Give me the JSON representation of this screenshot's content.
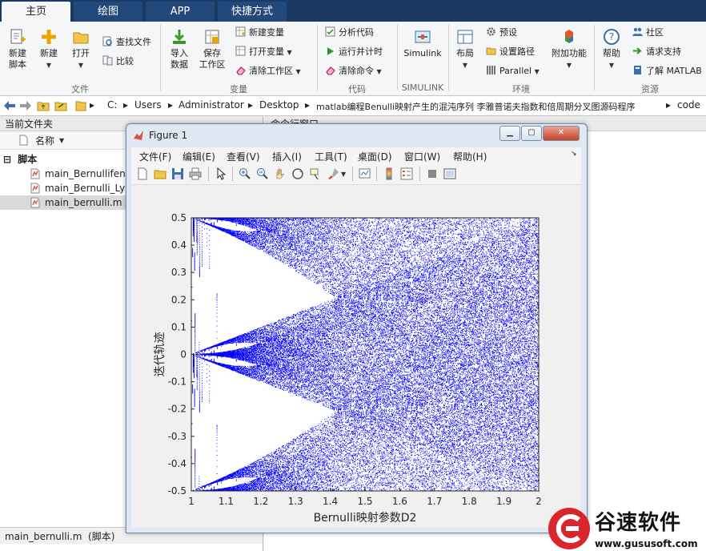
{
  "tabs": [
    {
      "label": "主页",
      "active": true
    },
    {
      "label": "绘图",
      "active": false
    },
    {
      "label": "APP",
      "active": false
    },
    {
      "label": "快捷方式",
      "active": false
    }
  ],
  "ribbon": {
    "new_script": [
      "新建",
      "脚本"
    ],
    "new": "新建",
    "open": "打开",
    "find_files": "查找文件",
    "compare": "比较",
    "group_file": "文件",
    "import": [
      "导入",
      "数据"
    ],
    "save_ws": [
      "保存",
      "工作区"
    ],
    "new_var": "新建变量",
    "open_var": "打开变量",
    "clear_ws": "清除工作区",
    "group_var": "变量",
    "analyze": "分析代码",
    "run_time": "运行并计时",
    "clear_cmd": "清除命令",
    "group_code": "代码",
    "simulink": "Simulink",
    "group_simulink": "SIMULINK",
    "layout": "布局",
    "prefs": "预设",
    "set_path": "设置路径",
    "parallel": "Parallel",
    "addons": "附加功能",
    "group_env": "环境",
    "help": "帮助",
    "community": "社区",
    "request_support": "请求支持",
    "learn_matlab": "了解 MATLAB",
    "group_resources": "资源"
  },
  "address": {
    "crumbs": [
      "C:",
      "Users",
      "Administrator",
      "Desktop",
      "matlab编程Benulli映射产生的混沌序列 李雅普诺夫指数和倍周期分叉图源码程序",
      "code"
    ]
  },
  "left_panel": {
    "title": "当前文件夹",
    "column_name": "名称",
    "folder": "脚本",
    "files": [
      "main_Bernullifenc",
      "main_Bernulli_Lya",
      "main_bernulli.m"
    ],
    "status": "main_bernulli.m  (脚本)"
  },
  "command_window": {
    "title": "命令行窗口"
  },
  "figure": {
    "title": "Figure 1",
    "menu": [
      "文件(F)",
      "编辑(E)",
      "查看(V)",
      "插入(I)",
      "工具(T)",
      "桌面(D)",
      "窗口(W)",
      "帮助(H)"
    ]
  },
  "chart_data": {
    "type": "scatter",
    "xlabel": "Bernulli映射参数D2",
    "ylabel": "迭代轨迹",
    "xlim": [
      1,
      2
    ],
    "ylim": [
      -0.5,
      0.5
    ],
    "xticks": [
      "1",
      "1.1",
      "1.2",
      "1.3",
      "1.4",
      "1.5",
      "1.6",
      "1.7",
      "1.8",
      "1.9",
      "2"
    ],
    "yticks": [
      "0.5",
      "0.4",
      "0.3",
      "0.2",
      "0.1",
      "0",
      "-0.1",
      "-0.2",
      "-0.3",
      "-0.4",
      "-0.5"
    ],
    "color": "#0000ff",
    "grid": false,
    "legend": "none"
  },
  "watermark": {
    "name": "谷速软件",
    "url": "www.gususoft.com"
  },
  "colors": {
    "tabbar": "#1b3a63",
    "plot_points": "#0000ff",
    "watermark_red": "#d9262c"
  }
}
